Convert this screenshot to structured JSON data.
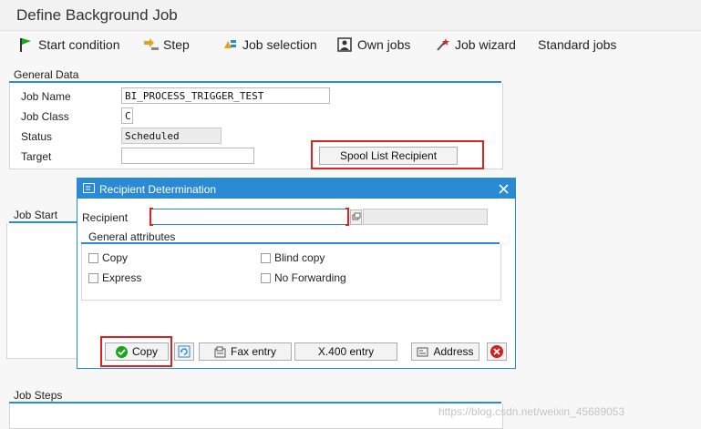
{
  "window": {
    "title": "Define Background Job"
  },
  "toolbar": {
    "start_condition": "Start condition",
    "step": "Step",
    "job_selection": "Job selection",
    "own_jobs": "Own jobs",
    "job_wizard": "Job wizard",
    "standard_jobs": "Standard jobs"
  },
  "general_data": {
    "header": "General Data",
    "job_name_label": "Job Name",
    "job_name_value": "BI_PROCESS_TRIGGER_TEST",
    "job_class_label": "Job Class",
    "job_class_value": "C",
    "status_label": "Status",
    "status_value": "Scheduled",
    "target_label": "Target",
    "target_value": "",
    "spool_button": "Spool List Recipient"
  },
  "job_start": {
    "header": "Job Start"
  },
  "job_steps": {
    "header": "Job Steps"
  },
  "dialog": {
    "title": "Recipient Determination",
    "recipient_label": "Recipient",
    "recipient_value": "",
    "general_attributes": "General attributes",
    "copy_cb": "Copy",
    "express_cb": "Express",
    "blind_copy_cb": "Blind copy",
    "no_forwarding_cb": "No Forwarding",
    "copy_button": "Copy",
    "fax_button": "Fax entry",
    "x400_button": "X.400 entry",
    "address_button": "Address"
  },
  "watermark": "https://blog.csdn.net/weixin_45689053",
  "colors": {
    "accent": "#2b8ad4",
    "highlight": "#dd2222",
    "ok": "#1aa51a",
    "cancel": "#d21f1f"
  }
}
